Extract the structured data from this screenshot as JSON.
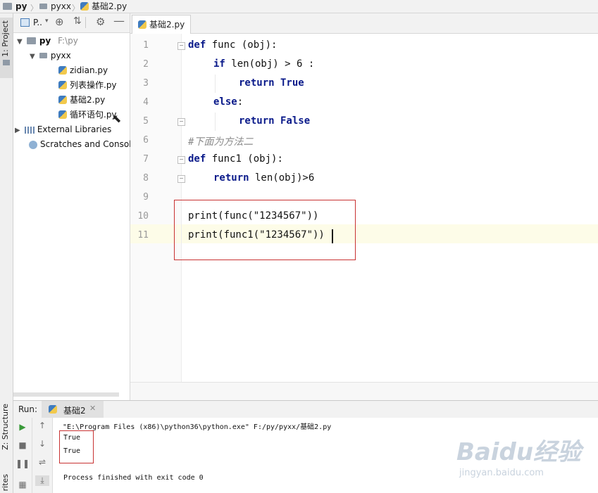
{
  "breadcrumb": {
    "root": "py",
    "folder": "pyxx",
    "file": "基础2.py"
  },
  "left_strip": {
    "project_tab": "1: Project",
    "structure_tab": "Z: Structure",
    "favorites_tab": "rites"
  },
  "project_panel": {
    "header_label": "P..",
    "tree": [
      {
        "label": "py",
        "extra": "F:\\py",
        "type": "folder"
      },
      {
        "label": "pyxx",
        "extra": "",
        "type": "folder"
      },
      {
        "label": "zidian.py",
        "extra": "",
        "type": "py"
      },
      {
        "label": "列表操作.py",
        "extra": "",
        "type": "py"
      },
      {
        "label": "基础2.py",
        "extra": "",
        "type": "py"
      },
      {
        "label": "循环语句.py",
        "extra": "",
        "type": "py"
      },
      {
        "label": "External Libraries",
        "extra": "",
        "type": "lib"
      },
      {
        "label": "Scratches and Consol",
        "extra": "",
        "type": "scratch"
      }
    ]
  },
  "editor": {
    "tab_label": "基础2.py",
    "line_numbers": [
      "1",
      "2",
      "3",
      "4",
      "5",
      "6",
      "7",
      "8",
      "9",
      "10",
      "11"
    ],
    "lines": [
      {
        "kw": "def",
        "rest": " func (obj):"
      },
      {
        "kw": "if",
        "rest": " len(obj) > 6 :"
      },
      {
        "kw": "return",
        "rest": " True"
      },
      {
        "kw": "else",
        "rest": ":"
      },
      {
        "kw": "return",
        "rest": " False"
      },
      {
        "kw": "",
        "rest": "#下面为方法二"
      },
      {
        "kw": "def",
        "rest": " func1 (obj):"
      },
      {
        "kw": "return",
        "rest": " len(obj)>6"
      },
      {
        "kw": "",
        "rest": ""
      },
      {
        "kw": "",
        "rest": "print(func(\"1234567\"))"
      },
      {
        "kw": "",
        "rest": "print(func1(\"1234567\"))"
      }
    ]
  },
  "run": {
    "label": "Run:",
    "tab_label": "基础2",
    "console_lines": [
      "\"E:\\Program Files (x86)\\python36\\python.exe\" F:/py/pyxx/基础2.py",
      "True",
      "True",
      "",
      "Process finished with exit code 0"
    ]
  },
  "watermark": {
    "brand": "Baidu经验",
    "url": "jingyan.baidu.com"
  }
}
